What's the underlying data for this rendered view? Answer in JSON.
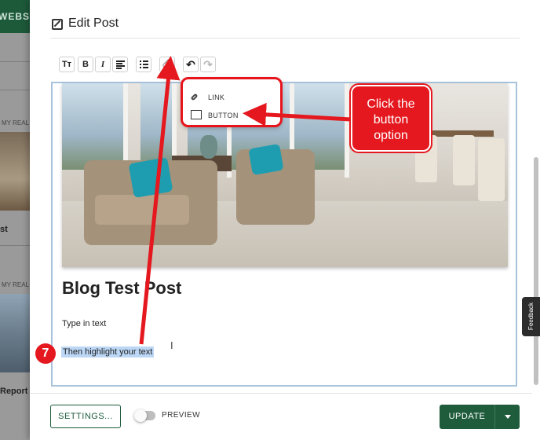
{
  "background": {
    "header_text": "WEBSI",
    "card_label_1": "MY REAL E",
    "card_text_1": "st",
    "card_label_2": "MY REAL E",
    "card_text_2": "Report"
  },
  "modal": {
    "title": "Edit Post",
    "close_glyph": "×"
  },
  "toolbar": {
    "text_size": "Tт",
    "bold": "B",
    "italic": "I",
    "link_glyph": "🔗",
    "undo_glyph": "↶",
    "redo_glyph": "↷"
  },
  "dropdown": {
    "items": [
      {
        "label": "LINK"
      },
      {
        "label": "BUTTON"
      }
    ]
  },
  "editor": {
    "post_title": "Blog Test Post",
    "body_text": "Type in text",
    "highlighted_text": "Then highlight your text",
    "cursor_glyph": "I"
  },
  "annotation": {
    "callout_line1": "Click the",
    "callout_line2": "button",
    "callout_line3": "option",
    "step_number": "7",
    "color": "#e4181e"
  },
  "feedback": {
    "label": "Feedback"
  },
  "footer": {
    "settings_label": "SETTINGS...",
    "preview_label": "PREVIEW",
    "update_label": "UPDATE"
  }
}
